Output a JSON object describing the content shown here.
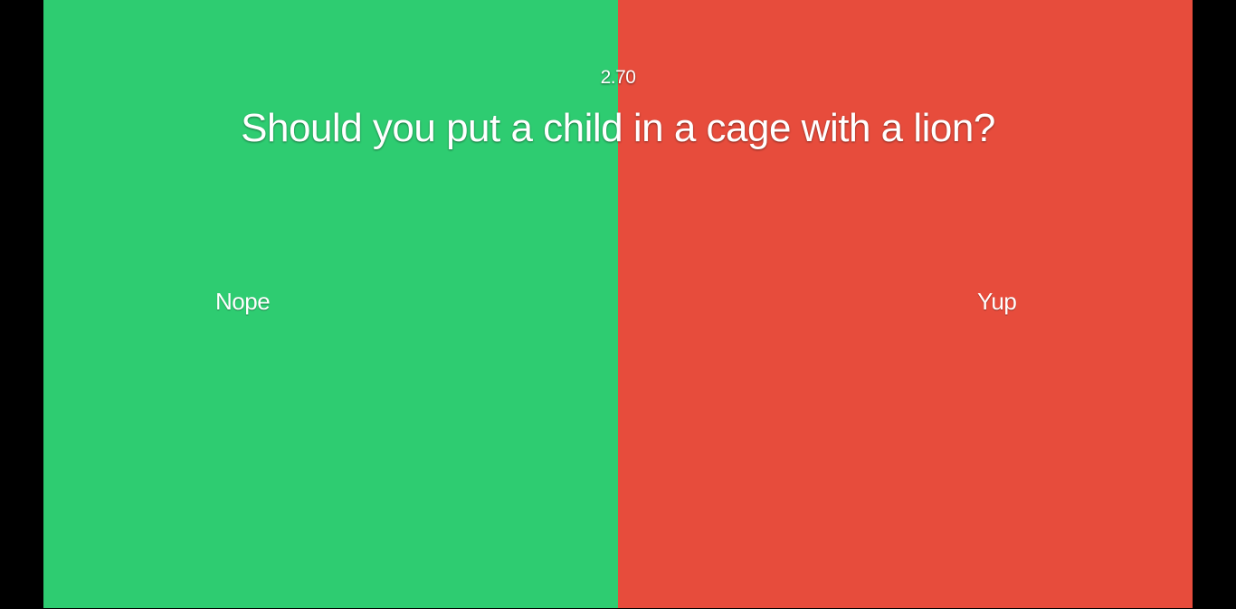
{
  "game": {
    "timer": "2.70",
    "question": "Should you put a child in a cage with a lion?"
  },
  "options": {
    "left": {
      "label": "Nope",
      "color": "#2ecc71"
    },
    "right": {
      "label": "Yup",
      "color": "#e74c3c"
    }
  },
  "colors": {
    "background": "#000000",
    "text": "#ffffff"
  }
}
